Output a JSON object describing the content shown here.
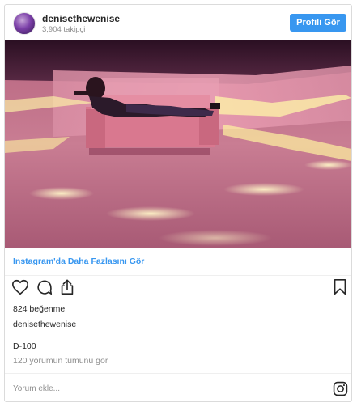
{
  "header": {
    "username": "denisethewenise",
    "followers": "3,904 takipçi",
    "profile_button": "Profili Gör"
  },
  "post": {
    "more_link": "Instagram'da Daha Fazlasını Gör",
    "likes": "824 beğenme",
    "author": "denisethewenise",
    "caption": "D-100",
    "comments_link": "120 yorumun tümünü gör"
  },
  "comment": {
    "placeholder": "Yorum ekle..."
  },
  "icons": {
    "like": "heart-icon",
    "comment": "comment-bubble-icon",
    "share": "share-icon",
    "save": "bookmark-icon",
    "brand": "instagram-logo-icon"
  },
  "colors": {
    "accent": "#3897f0",
    "text": "#262626",
    "muted": "#8e8e8e"
  }
}
